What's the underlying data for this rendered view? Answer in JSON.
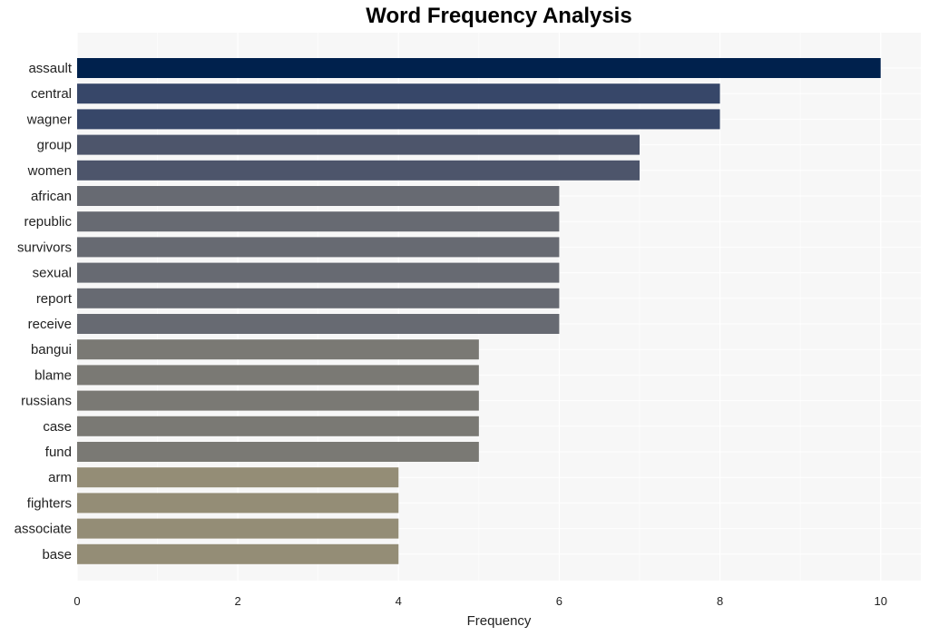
{
  "chart_data": {
    "type": "bar",
    "orientation": "horizontal",
    "title": "Word Frequency Analysis",
    "xlabel": "Frequency",
    "ylabel": "",
    "xlim": [
      0,
      10.5
    ],
    "xticks": [
      0,
      2,
      4,
      6,
      8,
      10
    ],
    "grid": true,
    "categories": [
      "assault",
      "central",
      "wagner",
      "group",
      "women",
      "african",
      "republic",
      "survivors",
      "sexual",
      "report",
      "receive",
      "bangui",
      "blame",
      "russians",
      "case",
      "fund",
      "arm",
      "fighters",
      "associate",
      "base"
    ],
    "values": [
      10,
      8,
      8,
      7,
      7,
      6,
      6,
      6,
      6,
      6,
      6,
      5,
      5,
      5,
      5,
      5,
      4,
      4,
      4,
      4
    ],
    "colors_by_value": {
      "10": "#00214d",
      "8": "#374769",
      "7": "#4d556b",
      "6": "#676a72",
      "5": "#7a7974",
      "4": "#948d76"
    }
  }
}
